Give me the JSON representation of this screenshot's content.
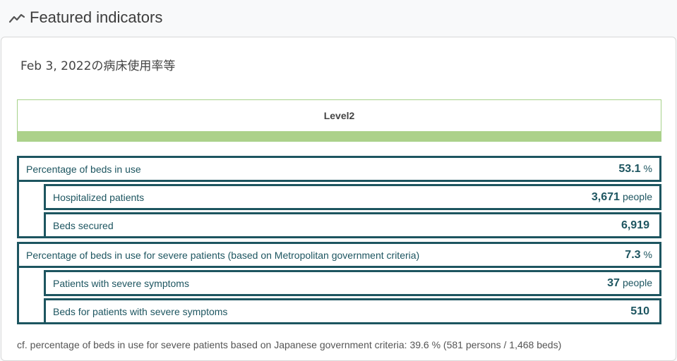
{
  "header": {
    "title": "Featured indicators",
    "icon": "trend-chart-icon"
  },
  "card": {
    "date_title": "Feb 3, 2022の病床使用率等",
    "level": {
      "label": "Level2",
      "color": "#acd18a"
    },
    "groups": [
      {
        "label": "Percentage of beds in use",
        "value": "53.1",
        "unit": "%",
        "children": [
          {
            "label": "Hospitalized patients",
            "value": "3,671",
            "unit": "people"
          },
          {
            "label": "Beds secured",
            "value": "6,919",
            "unit": ""
          }
        ]
      },
      {
        "label": "Percentage of beds in use for severe patients (based on Metropolitan government criteria)",
        "value": "7.3",
        "unit": "%",
        "children": [
          {
            "label": "Patients with severe symptoms",
            "value": "37",
            "unit": "people"
          },
          {
            "label": "Beds for patients with severe symptoms",
            "value": "510",
            "unit": ""
          }
        ]
      }
    ],
    "footnote": "cf. percentage of beds in use for severe patients based on Japanese government criteria: 39.6 % (581 persons / 1,468 beds)"
  },
  "colors": {
    "accent": "#1d5560",
    "level_bar": "#acd18a"
  }
}
